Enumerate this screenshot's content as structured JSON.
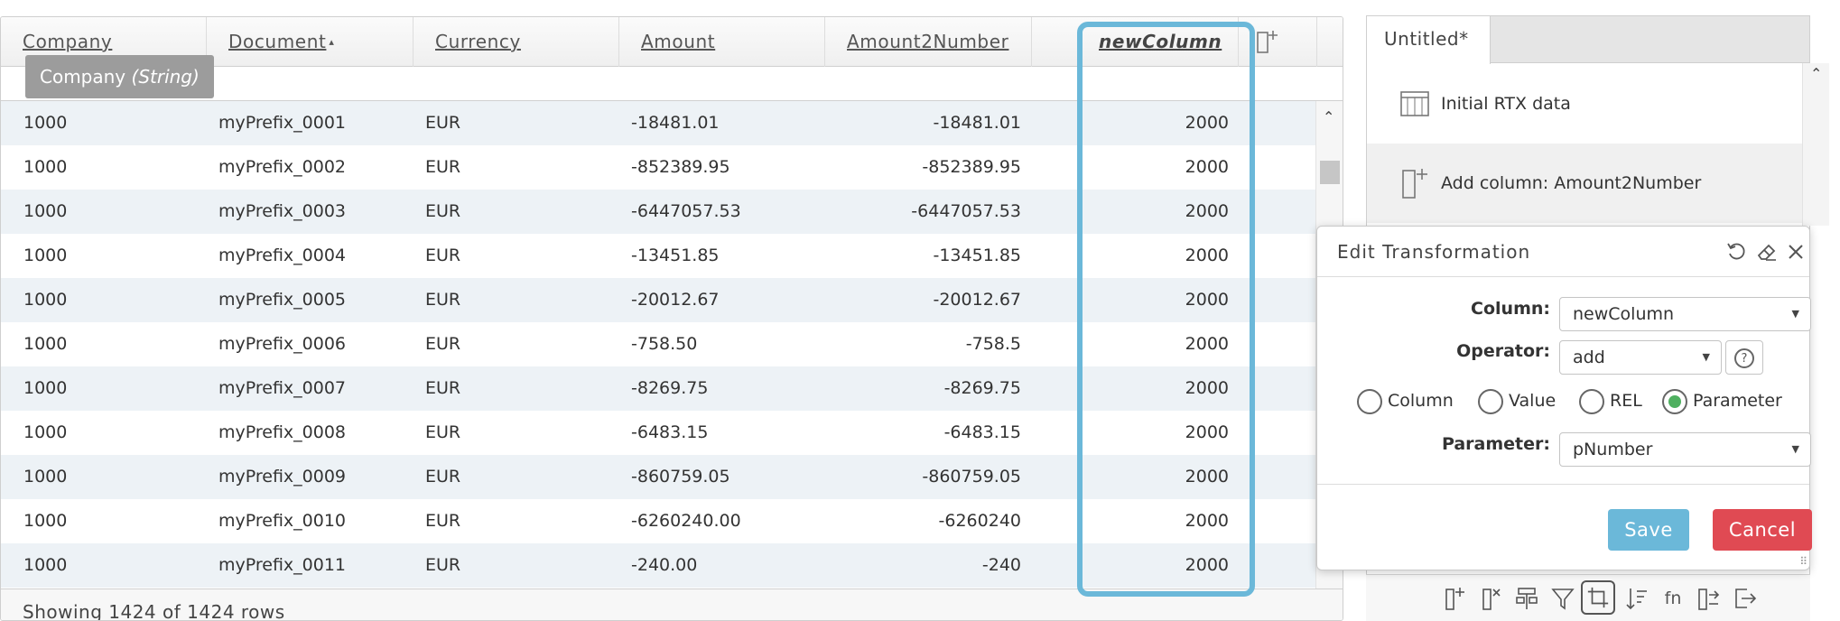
{
  "grid": {
    "columns": [
      {
        "label": "Company"
      },
      {
        "label": "Document",
        "sort": "▴"
      },
      {
        "label": "Currency"
      },
      {
        "label": "Amount"
      },
      {
        "label": "Amount2Number"
      },
      {
        "label": "newColumn"
      }
    ],
    "tooltip": {
      "name": "Company",
      "type": "(String)"
    },
    "rows": [
      [
        "1000",
        "myPrefix_0001",
        "EUR",
        "-18481.01",
        "-18481.01",
        "2000"
      ],
      [
        "1000",
        "myPrefix_0002",
        "EUR",
        "-852389.95",
        "-852389.95",
        "2000"
      ],
      [
        "1000",
        "myPrefix_0003",
        "EUR",
        "-6447057.53",
        "-6447057.53",
        "2000"
      ],
      [
        "1000",
        "myPrefix_0004",
        "EUR",
        "-13451.85",
        "-13451.85",
        "2000"
      ],
      [
        "1000",
        "myPrefix_0005",
        "EUR",
        "-20012.67",
        "-20012.67",
        "2000"
      ],
      [
        "1000",
        "myPrefix_0006",
        "EUR",
        "-758.50",
        "-758.5",
        "2000"
      ],
      [
        "1000",
        "myPrefix_0007",
        "EUR",
        "-8269.75",
        "-8269.75",
        "2000"
      ],
      [
        "1000",
        "myPrefix_0008",
        "EUR",
        "-6483.15",
        "-6483.15",
        "2000"
      ],
      [
        "1000",
        "myPrefix_0009",
        "EUR",
        "-860759.05",
        "-860759.05",
        "2000"
      ],
      [
        "1000",
        "myPrefix_0010",
        "EUR",
        "-6260240.00",
        "-6260240",
        "2000"
      ],
      [
        "1000",
        "myPrefix_0011",
        "EUR",
        "-240.00",
        "-240",
        "2000"
      ]
    ],
    "footer": "Showing 1424 of 1424 rows",
    "highlight_color": "#6bb8d9"
  },
  "panel": {
    "tab": "Untitled*",
    "steps": [
      {
        "label": "Initial RTX data",
        "icon": "table-icon"
      },
      {
        "label": "Add column: Amount2Number",
        "icon": "add-column-icon"
      }
    ],
    "toolbar_icons": [
      "add-column-icon",
      "remove-column-icon",
      "hierarchy-icon",
      "filter-icon",
      "crop-icon",
      "sort-icon",
      "fn",
      "split-column-icon",
      "export-icon"
    ]
  },
  "dialog": {
    "title": "Edit Transformation",
    "column_label": "Column:",
    "column_value": "newColumn",
    "operator_label": "Operator:",
    "operator_value": "add",
    "radios": [
      "Column",
      "Value",
      "REL",
      "Parameter"
    ],
    "selected_radio": "Parameter",
    "parameter_label": "Parameter:",
    "parameter_value": "pNumber",
    "save": "Save",
    "cancel": "Cancel",
    "save_color": "#6bb8d9",
    "cancel_color": "#e04a53",
    "radio_on_color": "#4fb060"
  }
}
